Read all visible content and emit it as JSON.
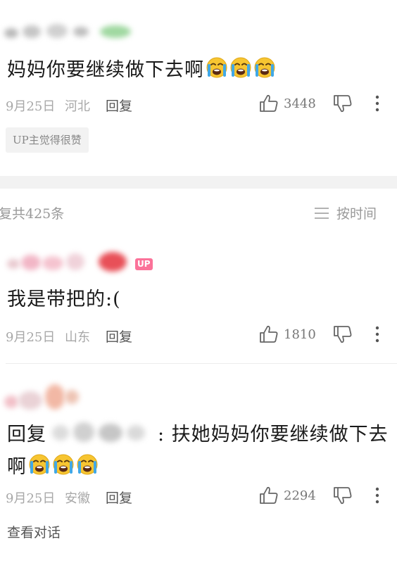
{
  "comment1": {
    "text": "妈妈你要继续做下去啊",
    "date": "9月25日",
    "location": "河北",
    "reply_label": "回复",
    "like_count": "3448",
    "tag": "UP主觉得很赞"
  },
  "section": {
    "reply_count": "复共425条",
    "sort_label": "按时间"
  },
  "comment2": {
    "badge": "UP",
    "text": "我是带把的:(",
    "date": "9月25日",
    "location": "山东",
    "reply_label": "回复",
    "like_count": "1810"
  },
  "comment3": {
    "reply_prefix": "回复",
    "text_line1": ": 扶她妈妈你要继续做下去",
    "text_line2": "啊",
    "date": "9月25日",
    "location": "安徽",
    "reply_label": "回复",
    "like_count": "2294",
    "view_conversation": "查看对话"
  },
  "icons": {
    "like": "thumbs-up-icon",
    "dislike": "thumbs-down-icon",
    "more": "more-vertical-icon",
    "sort": "menu-lines-icon",
    "emoji": "crying-face-icon"
  },
  "colors": {
    "badge_up": "#fb7299",
    "meta_text": "#a8a8a8",
    "emoji_face": "#f7c531",
    "emoji_tears": "#41a8e6"
  }
}
